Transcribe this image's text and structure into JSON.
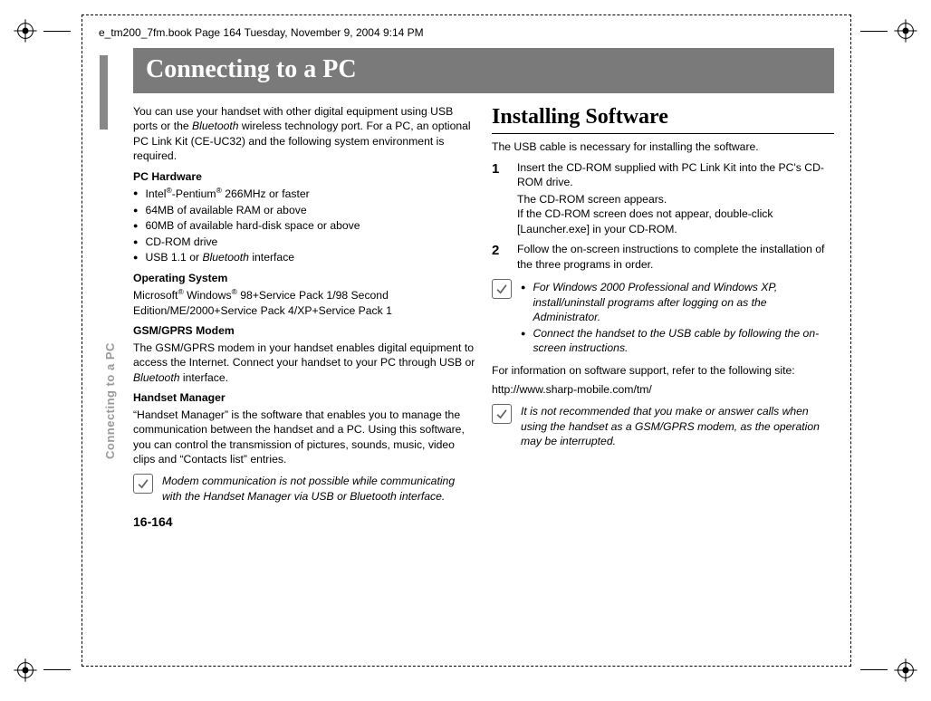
{
  "header": "e_tm200_7fm.book  Page 164  Tuesday, November 9, 2004  9:14 PM",
  "title": "Connecting to a PC",
  "side_tab": "Connecting to a PC",
  "page_number": "16-164",
  "left": {
    "intro_a": "You can use your handset with other digital equipment using USB ports or the ",
    "intro_b_italic": "Bluetooth",
    "intro_c": " wireless technology port. For a PC, an optional PC Link Kit (CE-UC32) and the following system environment is required.",
    "hw_head": "PC Hardware",
    "hw_items": [
      "Intel®-Pentium® 266MHz or faster",
      "64MB of available RAM or above",
      "60MB of available hard-disk space or above",
      "CD-ROM drive",
      "USB 1.1 or Bluetooth interface"
    ],
    "os_head": "Operating System",
    "os_text": "Microsoft® Windows® 98+Service Pack 1/98 Second Edition/ME/2000+Service Pack 4/XP+Service Pack 1",
    "modem_head": "GSM/GPRS Modem",
    "modem_text_a": "The GSM/GPRS modem in your handset enables digital equipment to access the Internet. Connect your handset to your PC through USB or ",
    "modem_text_b_italic": "Bluetooth",
    "modem_text_c": " interface.",
    "hm_head": "Handset Manager",
    "hm_text": "“Handset Manager” is the software that enables you to manage the communication between the handset and a PC. Using this software, you can control the transmission of pictures, sounds, music, video clips and “Contacts list” entries.",
    "note": "Modem communication is not possible while communicating with the Handset Manager via USB or Bluetooth interface."
  },
  "right": {
    "section": "Installing Software",
    "intro": "The USB cable is necessary for installing the software.",
    "steps": [
      {
        "num": "1",
        "main": "Insert the CD-ROM supplied with PC Link Kit into the PC's CD-ROM drive.",
        "sub1": "The CD-ROM screen appears.",
        "sub2": "If the CD-ROM screen does not appear, double-click [Launcher.exe] in your CD-ROM."
      },
      {
        "num": "2",
        "main": "Follow the on-screen instructions to complete the installation of the three programs in order."
      }
    ],
    "note1_items": [
      "For Windows 2000 Professional and Windows XP, install/uninstall programs after logging on as the Administrator.",
      "Connect the handset to the USB cable by following the on-screen instructions."
    ],
    "support_a": "For information on software support, refer to the following site:",
    "support_b": "http://www.sharp-mobile.com/tm/",
    "note2": "It is not recommended that you make or answer calls when using the handset as a GSM/GPRS modem, as the operation may be interrupted."
  }
}
